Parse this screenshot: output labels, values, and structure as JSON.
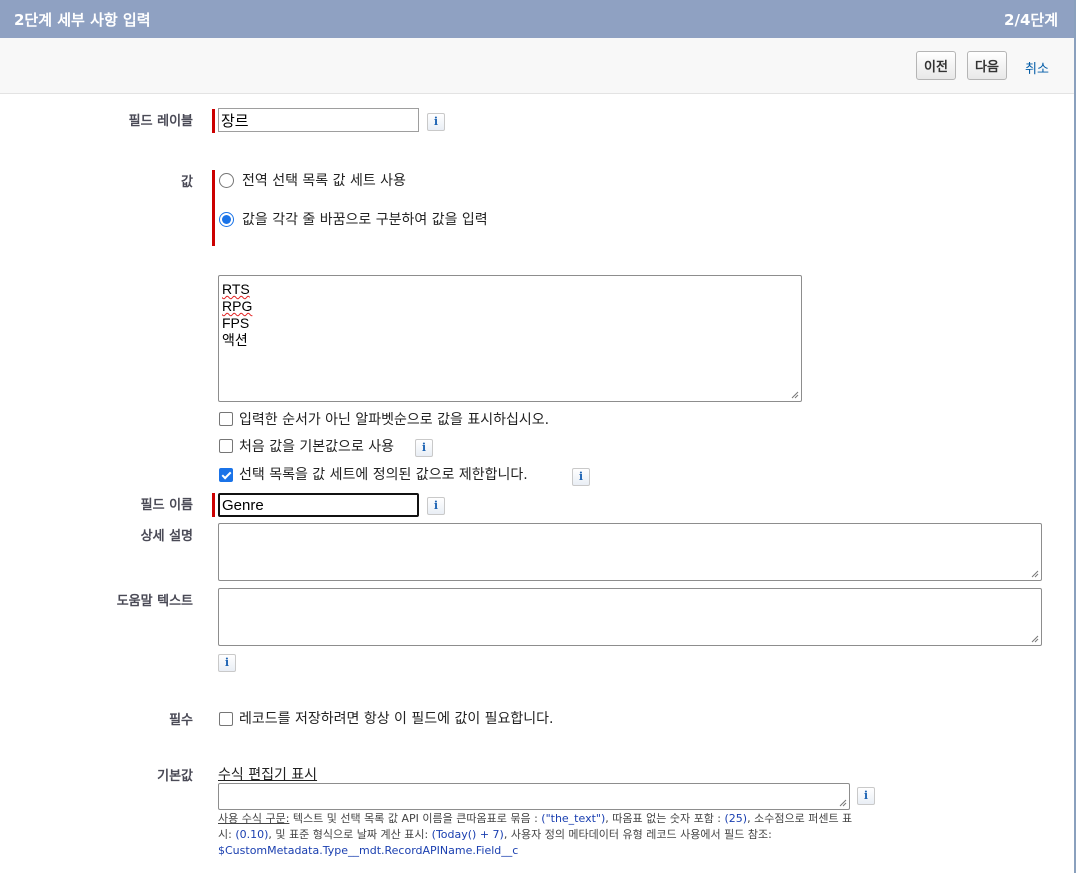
{
  "header": {
    "title": "2단계 세부 사항 입력",
    "step": "2/4단계"
  },
  "toolbar": {
    "prev_label": "이전",
    "next_label": "다음",
    "cancel_label": "취소"
  },
  "field_label": {
    "label": "필드 레이블",
    "value": "장르"
  },
  "values": {
    "label": "값",
    "options": [
      {
        "label": "전역 선택 목록 값 세트 사용",
        "selected": false
      },
      {
        "label": "값을 각각 줄 바꿈으로 구분하여 값을 입력",
        "selected": true
      }
    ],
    "lines": [
      "RTS",
      "RPG",
      "FPS",
      "액션"
    ],
    "checkboxes": [
      {
        "label": "입력한 순서가 아닌 알파벳순으로 값을 표시하십시오.",
        "checked": false
      },
      {
        "label": "처음 값을 기본값으로 사용",
        "checked": false
      },
      {
        "label": "선택 목록을 값 세트에 정의된 값으로 제한합니다.",
        "checked": true
      }
    ]
  },
  "field_name": {
    "label": "필드 이름",
    "value": "Genre"
  },
  "description": {
    "label": "상세 설명",
    "value": ""
  },
  "help_text": {
    "label": "도움말 텍스트",
    "value": ""
  },
  "required": {
    "label": "필수",
    "checkbox_label": "레코드를 저장하려면 항상 이 필드에 값이 필요합니다.",
    "checked": false
  },
  "default_value": {
    "label": "기본값",
    "formula_link": "수식 편집기 표시",
    "value": "",
    "syntax": {
      "title": "사용 수식 구문:",
      "t1": " 텍스트 및 선택 목록 값 API 이름을 큰따옴표로 묶음 : ",
      "e1": "(\"the_text\")",
      "t2": ", 따옴표 없는 숫자 포함 : ",
      "e2": "(25)",
      "t3": ", 소수점으로 퍼센트 표시: ",
      "e3": "(0.10)",
      "t4": ", 및 표준 형식으로 날짜 계산 표시: ",
      "e4": "(Today() + 7)",
      "t5": ", 사용자 정의 메타데이터 유형 레코드 사용에서 필드 참조: ",
      "e5": "$CustomMetadata.Type__mdt.RecordAPIName.Field__c"
    }
  },
  "icons": {
    "info": "info-icon",
    "resize": "resize-grip-icon"
  },
  "colors": {
    "header_bg": "#8fa1c2",
    "required_bar": "#cc0000",
    "link": "#015ba7",
    "accent": "#1a73e8"
  }
}
